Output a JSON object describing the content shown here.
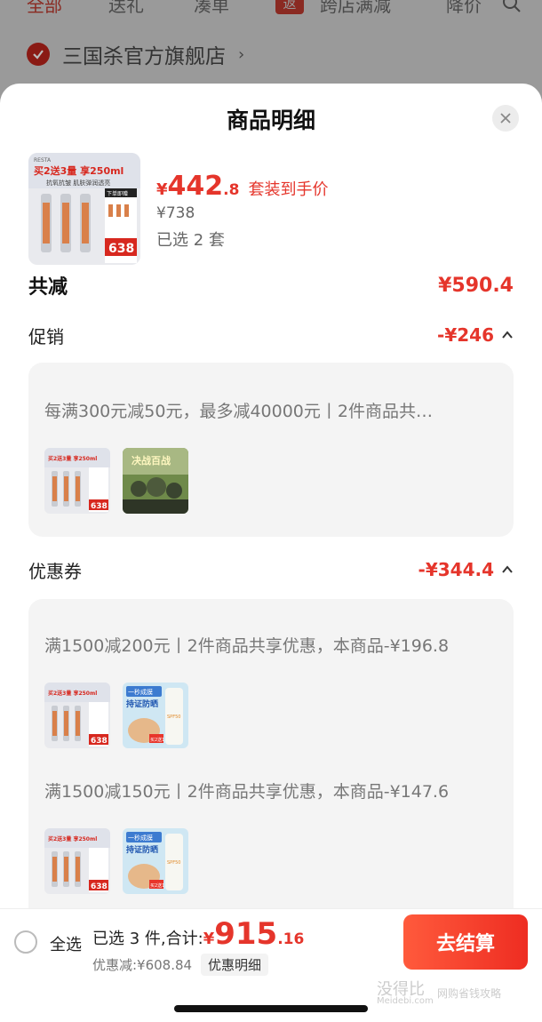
{
  "background": {
    "tabs": [
      "全部",
      "送礼",
      "凑单",
      "跨店满减",
      "降价"
    ],
    "tab_badge": "返",
    "store_name": "三国杀官方旗舰店"
  },
  "sheet": {
    "title": "商品明细",
    "product": {
      "price_yen": "¥",
      "price_int": "442",
      "price_dec": ".8",
      "price_tag": "套装到手价",
      "original_price": "¥738",
      "selected": "已选 2 套",
      "thumb_headline": "买2送3量 享250ml",
      "thumb_sub": "抗氧抗皱 肌肤弹润透亮",
      "thumb_price": "638",
      "thumb_badge": "下单即赠",
      "thumb_brand": "RESTA"
    },
    "total": {
      "label": "共减",
      "value": "¥590.4"
    },
    "promo": {
      "label": "促销",
      "value": "-¥246",
      "rule": "每满300元减50元，最多减40000元丨2件商品共…",
      "game_thumb_text": "决战百战"
    },
    "coupon": {
      "label": "优惠券",
      "value": "-¥344.4",
      "rule1": "满1500减200元丨2件商品共享优惠，本商品-¥196.8",
      "rule2": "满1500减150元丨2件商品共享优惠，本商品-¥147.6",
      "sun_thumb_line1": "一秒成膜",
      "sun_thumb_line2": "持证防晒",
      "sun_thumb_spf": "SPF50",
      "sun_thumb_badge": "买2送1"
    }
  },
  "bottom": {
    "select_all": "全选",
    "summary": "已选 3 件,合计:",
    "sum_yen": "¥",
    "sum_int": "915",
    "sum_dec": ".16",
    "discount": "优惠减:¥608.84",
    "detail_link": "优惠明细",
    "checkout": "去结算"
  },
  "watermark": {
    "main": "没得比",
    "sub": "网购省钱攻略",
    "url": "Meidebi.com"
  },
  "colors": {
    "accent": "#e5352b",
    "checkout_start": "#ff5a3c",
    "checkout_end": "#ee2d22"
  }
}
